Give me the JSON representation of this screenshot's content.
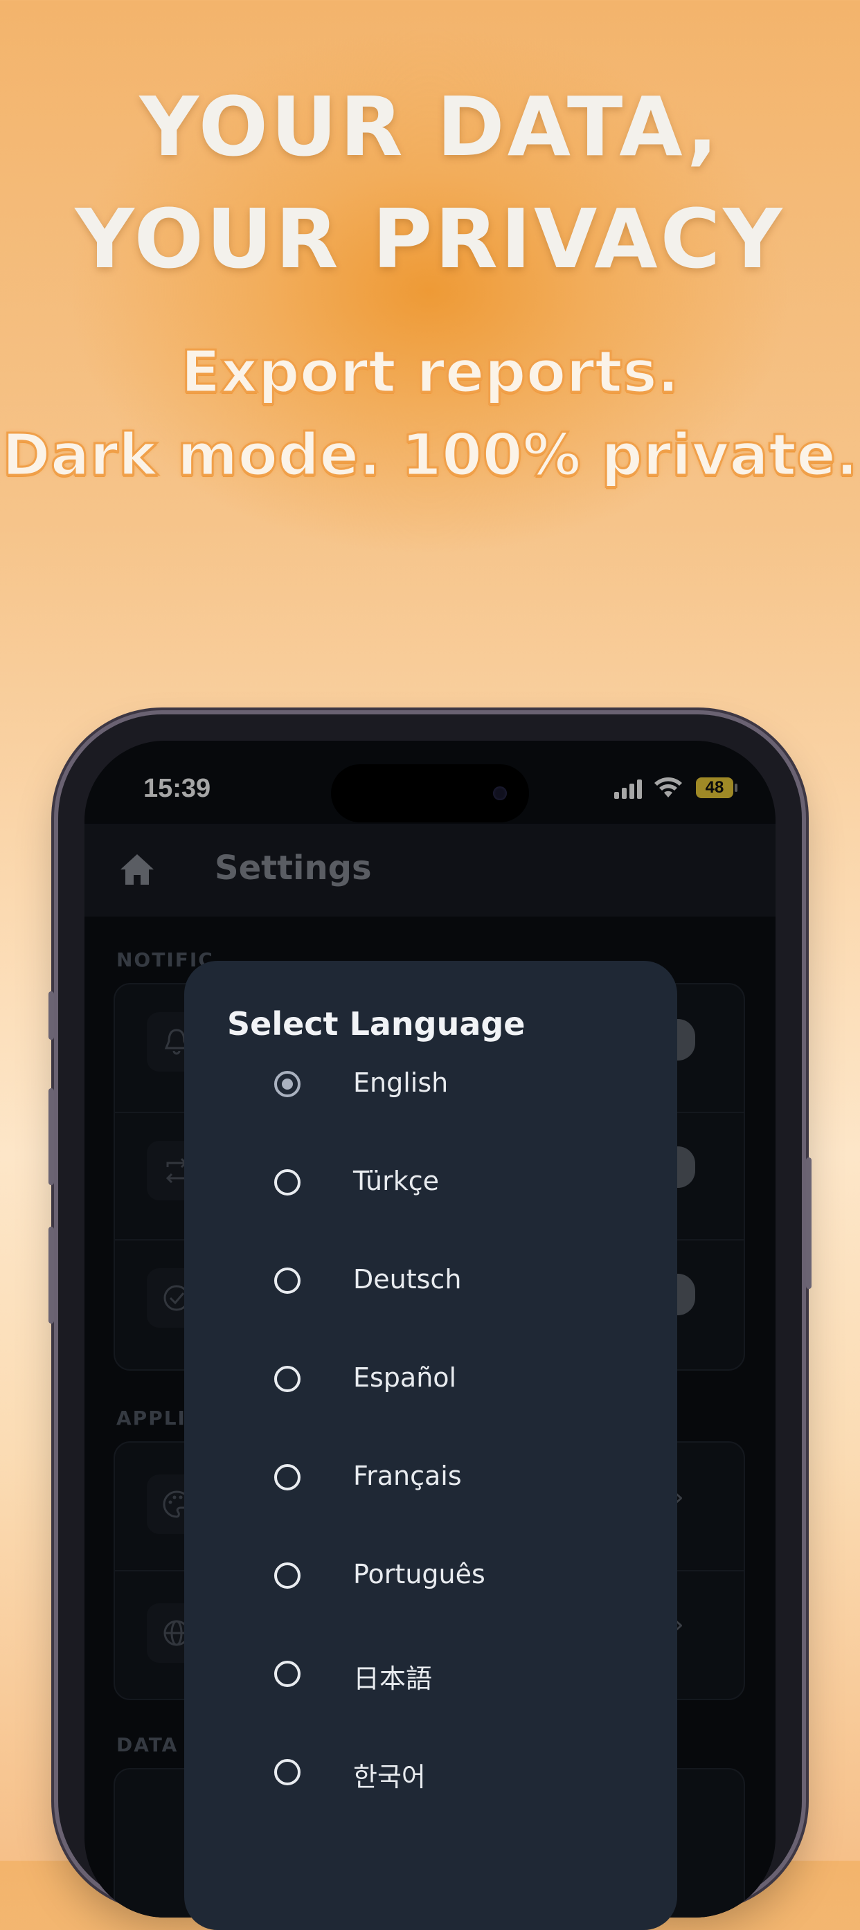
{
  "promo": {
    "headline_line1": "YOUR DATA,",
    "headline_line2": "YOUR PRIVACY",
    "sub_line1": "Export reports.",
    "sub_line2": "Dark mode. 100% private."
  },
  "status_bar": {
    "time": "15:39",
    "battery": "48"
  },
  "app_bar": {
    "title": "Settings",
    "icon": "home-icon"
  },
  "sections": {
    "notifications_label": "NOTIFIC",
    "application_label": "APPLIC",
    "data_label": "DATA"
  },
  "dialog": {
    "title": "Select Language",
    "selected": "English",
    "options": [
      {
        "label": "English",
        "selected": true
      },
      {
        "label": "Türkçe",
        "selected": false
      },
      {
        "label": "Deutsch",
        "selected": false
      },
      {
        "label": "Español",
        "selected": false
      },
      {
        "label": "Français",
        "selected": false
      },
      {
        "label": "Português",
        "selected": false
      },
      {
        "label": "日本語",
        "selected": false
      },
      {
        "label": "한국어",
        "selected": false
      }
    ]
  },
  "colors": {
    "accent_orange": "#ee9a36",
    "dialog_bg": "#1f2835",
    "battery": "#f5d33b"
  }
}
